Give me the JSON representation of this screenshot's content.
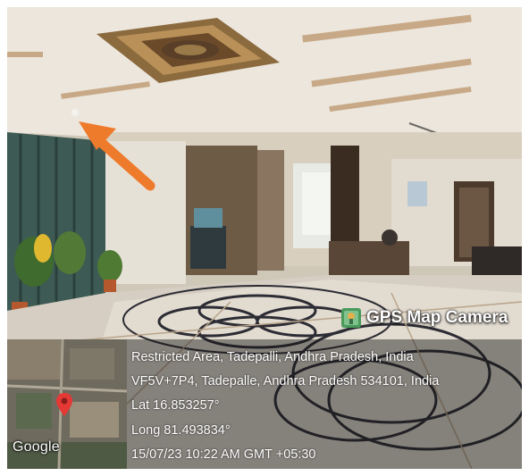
{
  "watermark": {
    "brand": "GPS Map Camera",
    "map_label": "Google",
    "marker_icon": "map-pin-icon",
    "marker_color": "#e53935",
    "address_line_1": "Restricted Area, Tadepalli, Andhra Pradesh, India",
    "address_line_2": "VF5V+7P4, Tadepalle, Andhra Pradesh 534101, India",
    "latitude": "Lat 16.853257°",
    "longitude": "Long 81.493834°",
    "timestamp": "15/07/23 10:22 AM GMT +05:30"
  },
  "annotation": {
    "arrow_color": "#ee7a2c",
    "arrow_icon": "arrow-up-left-icon"
  }
}
